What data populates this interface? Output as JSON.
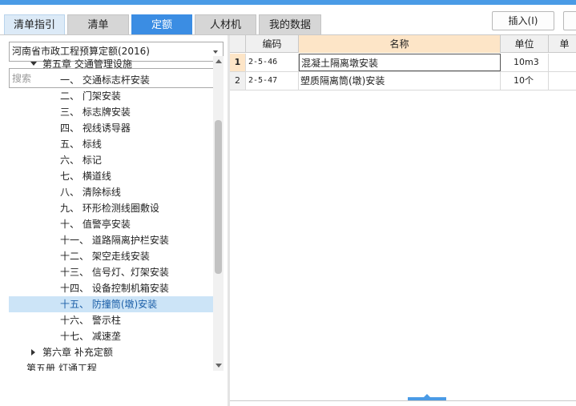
{
  "tabs": [
    "清单指引",
    "清单",
    "定额",
    "人材机",
    "我的数据"
  ],
  "active_tab": "定额",
  "toolbar": {
    "insert_label": "插入(I)"
  },
  "left": {
    "quota_select": "河南省市政工程预算定额(2016)",
    "search_placeholder": "搜索",
    "tree": [
      {
        "label": "第五章 交通管理设施",
        "level": 1,
        "toggle": "expanded"
      },
      {
        "label": "一、  交通标志杆安装",
        "level": 2
      },
      {
        "label": "二、  门架安装",
        "level": 2
      },
      {
        "label": "三、  标志牌安装",
        "level": 2
      },
      {
        "label": "四、  视线诱导器",
        "level": 2
      },
      {
        "label": "五、  标线",
        "level": 2
      },
      {
        "label": "六、  标记",
        "level": 2
      },
      {
        "label": "七、  横道线",
        "level": 2
      },
      {
        "label": "八、  清除标线",
        "level": 2
      },
      {
        "label": "九、  环形检测线圈敷设",
        "level": 2
      },
      {
        "label": "十、  值警亭安装",
        "level": 2
      },
      {
        "label": "十一、  道路隔离护栏安装",
        "level": 2
      },
      {
        "label": "十二、  架空走线安装",
        "level": 2
      },
      {
        "label": "十三、  信号灯、灯架安装",
        "level": 2
      },
      {
        "label": "十四、  设备控制机箱安装",
        "level": 2
      },
      {
        "label": "十五、  防撞筒(墩)安装",
        "level": 2,
        "selected": true
      },
      {
        "label": "十六、  警示柱",
        "level": 2
      },
      {
        "label": "十七、  减速垄",
        "level": 2
      },
      {
        "label": "第六章 补充定额",
        "level": 1,
        "toggle": "collapsed"
      },
      {
        "label": "第五册 灯通工程",
        "level": 0
      }
    ]
  },
  "grid": {
    "columns": [
      "",
      "编码",
      "名称",
      "单位",
      "单"
    ],
    "rows": [
      {
        "index": "1",
        "code": "2-5-46",
        "name": "混凝土隔离墩安装",
        "unit": "10m3",
        "active": true
      },
      {
        "index": "2",
        "code": "2-5-47",
        "name": "塑质隔离筒(墩)安装",
        "unit": "10个"
      }
    ]
  },
  "colors": {
    "accent": "#3b8de3",
    "header_highlight": "#fde5c7",
    "selection": "#cce4f7"
  }
}
